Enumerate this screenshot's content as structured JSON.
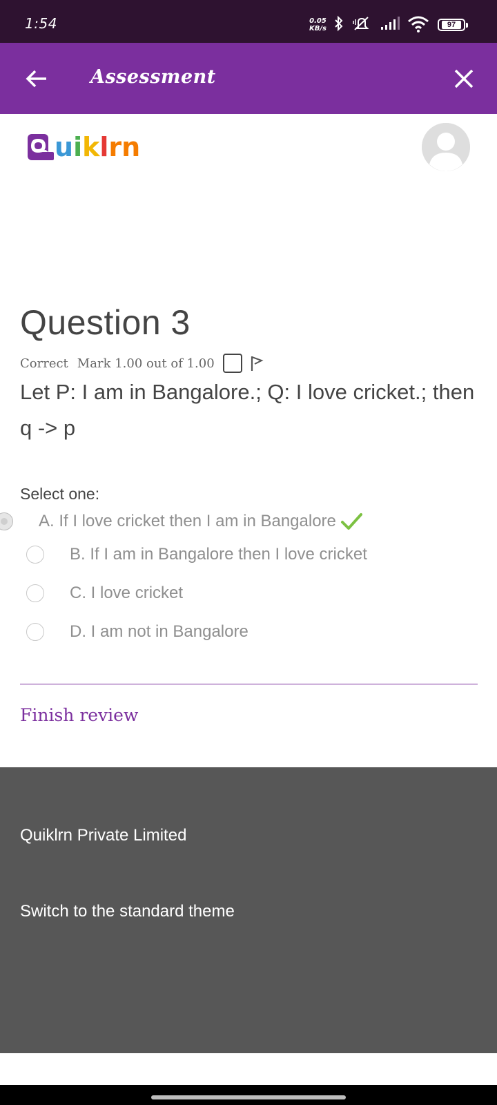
{
  "status_bar": {
    "time": "1:54",
    "speed_value": "0.05",
    "speed_unit": "KB/s",
    "battery": "97",
    "icons": [
      "bluetooth-icon",
      "mute-icon",
      "signal-icon",
      "wifi-icon",
      "battery-icon"
    ]
  },
  "app_bar": {
    "title": "Assessment",
    "back_icon": "arrow-left-icon",
    "close_icon": "close-icon",
    "color": "#7b2f9e"
  },
  "header": {
    "logo_text": "uiklrn",
    "logo_letters": [
      {
        "char": "u",
        "color": "#3b98d6"
      },
      {
        "char": "i",
        "color": "#4caf50"
      },
      {
        "char": "k",
        "color": "#f2b705"
      },
      {
        "char": "l",
        "color": "#e53935"
      },
      {
        "char": "r",
        "color": "#f57c00"
      },
      {
        "char": "n",
        "color": "#f57c00"
      }
    ],
    "logo_q_color": "#7b2f9e",
    "avatar_icon": "user-avatar-icon"
  },
  "question": {
    "title": "Question 3",
    "status": "Correct",
    "mark": "Mark 1.00 out of 1.00",
    "text": "Let P: I am in Bangalore.; Q: I love cricket.; then q -> p",
    "select_label": "Select one:",
    "options": [
      {
        "label": "A. If I love cricket then I am in Bangalore",
        "selected": true,
        "correct": true
      },
      {
        "label": "B. If I am in Bangalore then I love cricket",
        "selected": false
      },
      {
        "label": "C. I love cricket",
        "selected": false
      },
      {
        "label": "D. I am not in Bangalore",
        "selected": false
      }
    ]
  },
  "actions": {
    "finish_review": "Finish review"
  },
  "footer": {
    "company": "Quiklrn Private Limited",
    "switch_theme": "Switch to the standard theme"
  },
  "colors": {
    "status_bar_bg": "#2e1230",
    "accent": "#7b2f9e",
    "footer_bg": "#575757",
    "correct_check": "#7cc142"
  }
}
